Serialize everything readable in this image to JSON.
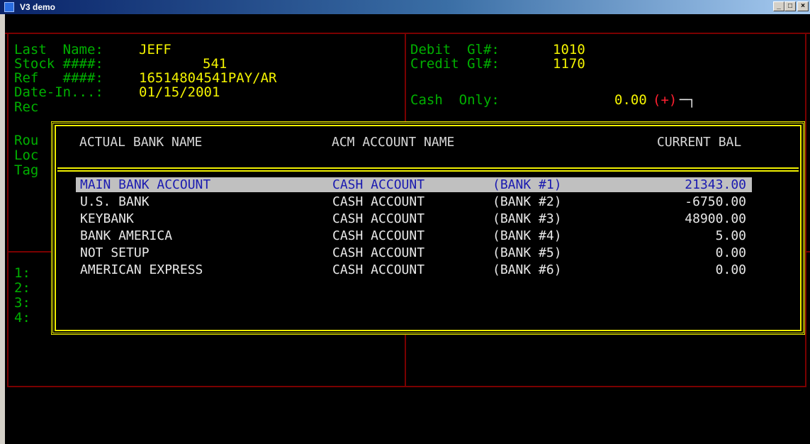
{
  "window": {
    "title": "V3 demo"
  },
  "form": {
    "last_name_label": "Last  Name:",
    "last_name_value": "JEFF",
    "stock_label": "Stock ####:",
    "stock_value": "541",
    "ref_label": "Ref   ####:",
    "ref_value": "16514804541PAY/AR",
    "date_label": "Date-In...:",
    "date_value": "01/15/2001",
    "rec_label": "Rec",
    "rou_label": "Rou",
    "loc_label": "Loc",
    "tag_label": "Tag",
    "debit_label": "Debit  Gl#:",
    "debit_value": "1010",
    "credit_label": "Credit Gl#:",
    "credit_value": "1170",
    "cash_label": "Cash  Only:",
    "cash_value": "0.00",
    "cash_sign": "(+)",
    "cash_marker": "─┐",
    "lines": [
      "1:",
      "2:",
      "3:",
      "4:"
    ]
  },
  "bank_dialog": {
    "headers": {
      "bank_name": "ACTUAL BANK NAME",
      "acm_name": "ACM ACCOUNT NAME",
      "balance": "CURRENT BAL"
    },
    "rows": [
      {
        "bank": "MAIN BANK ACCOUNT",
        "account": "CASH ACCOUNT",
        "bank_no": "(BANK #1)",
        "balance": "21343.00",
        "selected": true
      },
      {
        "bank": "U.S. BANK",
        "account": "CASH ACCOUNT",
        "bank_no": "(BANK #2)",
        "balance": "-6750.00",
        "selected": false
      },
      {
        "bank": "KEYBANK",
        "account": "CASH ACCOUNT",
        "bank_no": "(BANK #3)",
        "balance": "48900.00",
        "selected": false
      },
      {
        "bank": "BANK AMERICA",
        "account": "CASH ACCOUNT",
        "bank_no": "(BANK #4)",
        "balance": "5.00",
        "selected": false
      },
      {
        "bank": "NOT SETUP",
        "account": "CASH ACCOUNT",
        "bank_no": "(BANK #5)",
        "balance": "0.00",
        "selected": false
      },
      {
        "bank": "AMERICAN EXPRESS",
        "account": "CASH ACCOUNT",
        "bank_no": "(BANK #6)",
        "balance": "0.00",
        "selected": false
      }
    ]
  }
}
